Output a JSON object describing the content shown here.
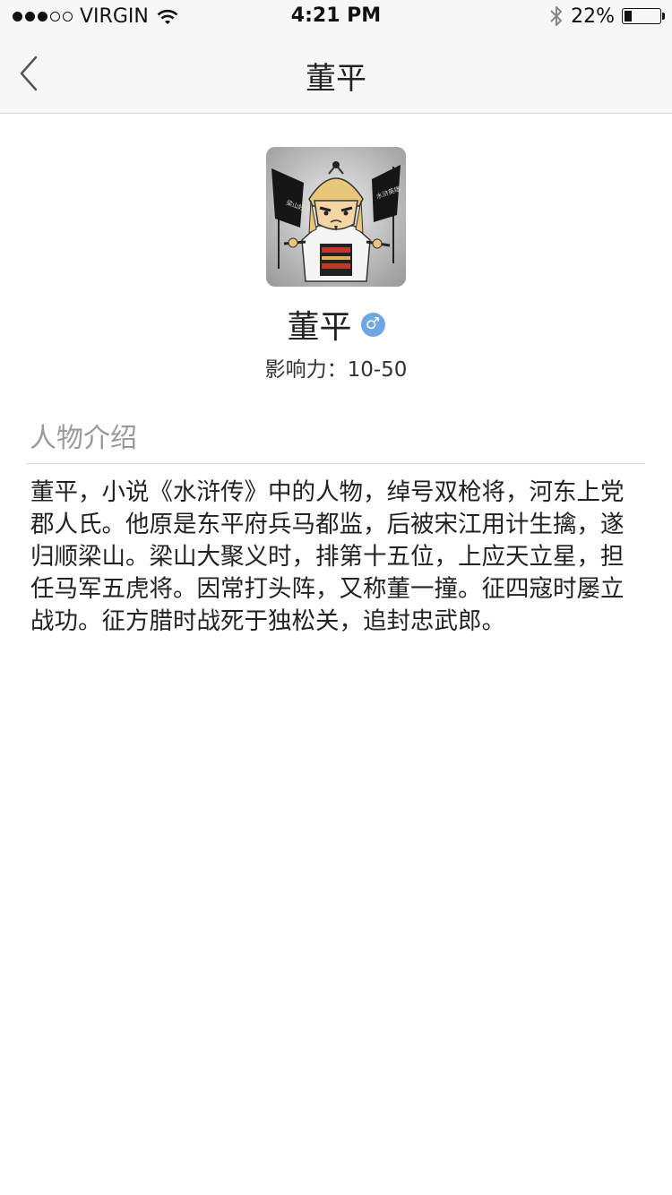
{
  "status_bar": {
    "carrier": "VIRGIN",
    "time": "4:21 PM",
    "battery_percent": "22%",
    "battery_level": 0.22,
    "signal_bars_filled": 3,
    "signal_bars_total": 5
  },
  "nav": {
    "title": "董平",
    "back_icon": "chevron-left-icon"
  },
  "profile": {
    "name": "董平",
    "gender_symbol": "♂",
    "gender_color": "#6fa6e6",
    "influence": "影响力：10-50"
  },
  "intro": {
    "title": "人物介绍",
    "text": "董平，小说《水浒传》中的人物，绰号双枪将，河东上党郡人氏。他原是东平府兵马都监，后被宋江用计生擒，遂归顺梁山。梁山大聚义时，排第十五位，上应天立星，担任马军五虎将。因常打头阵，又称董一撞。征四寇时屡立战功。征方腊时战死于独松关，追封忠武郎。"
  }
}
